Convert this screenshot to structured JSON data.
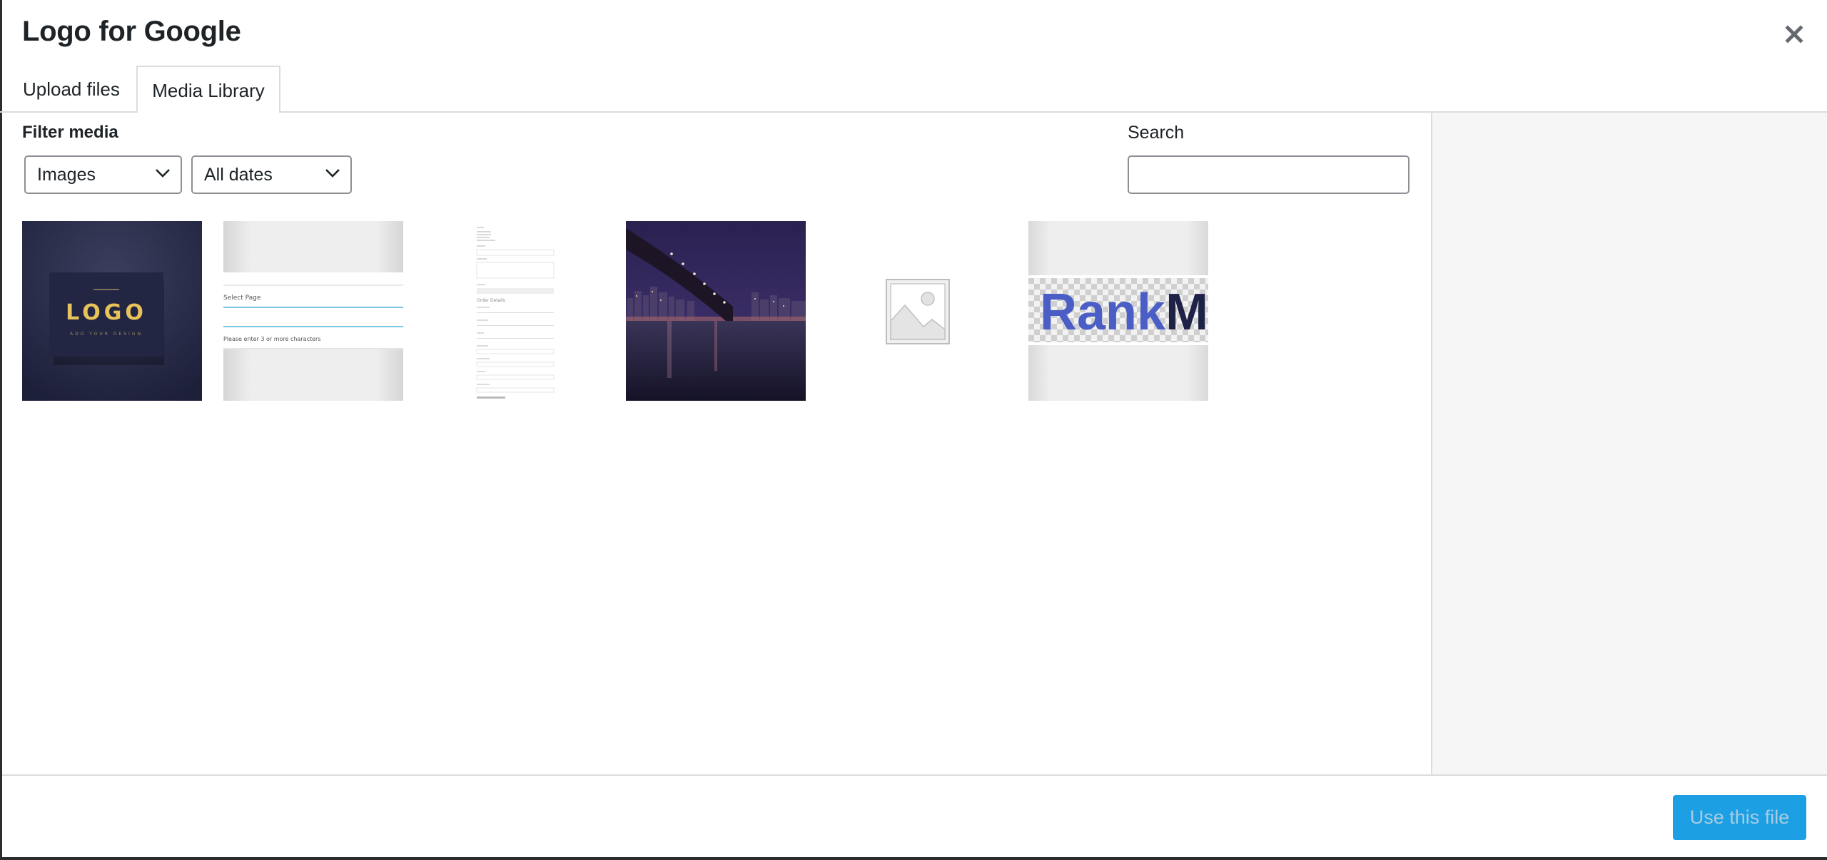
{
  "modal": {
    "title": "Logo for Google",
    "close_icon": "close-icon"
  },
  "tabs": [
    {
      "label": "Upload files",
      "active": false
    },
    {
      "label": "Media Library",
      "active": true
    }
  ],
  "filters": {
    "label": "Filter media",
    "type_select": {
      "value": "Images"
    },
    "date_select": {
      "value": "All dates"
    }
  },
  "search": {
    "label": "Search",
    "value": "",
    "placeholder": ""
  },
  "media_items": [
    {
      "kind": "logo-mockup",
      "text": "LOGO",
      "subtext": "ADD YOUR DESIGN"
    },
    {
      "kind": "select-page-screenshot",
      "text": "Select Page",
      "subtext": "Please enter 3 or more characters"
    },
    {
      "kind": "form-screenshot",
      "text": "Order Details"
    },
    {
      "kind": "city-bridge-night-photo"
    },
    {
      "kind": "placeholder-image"
    },
    {
      "kind": "rankmath-logo",
      "text": "Rank",
      "text2": "M"
    }
  ],
  "footer": {
    "use_button_label": "Use this file"
  },
  "colors": {
    "primary_button": "#1d9fe3",
    "primary_button_text_disabled": "#a7cde3",
    "sidebar_bg": "#f6f6f6",
    "border": "#dcdcde",
    "logo_gold": "#e8c25a",
    "rank_blue": "#4a5ec5"
  }
}
